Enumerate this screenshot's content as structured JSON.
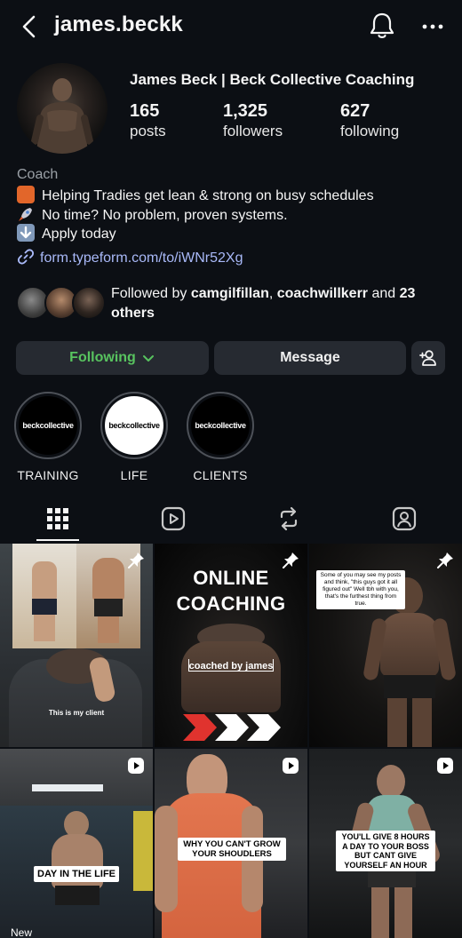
{
  "header": {
    "username": "james.beckk"
  },
  "profile": {
    "display_name": "James Beck | Beck Collective Coaching",
    "stats": [
      {
        "value": "165",
        "label": "posts"
      },
      {
        "value": "1,325",
        "label": "followers"
      },
      {
        "value": "627",
        "label": "following"
      }
    ],
    "category": "Coach",
    "bio": [
      {
        "emoji": "safety-vest",
        "text": "Helping Tradies get lean & strong on busy schedules"
      },
      {
        "emoji": "rocket",
        "text": "No time? No problem, proven systems."
      },
      {
        "emoji": "down-arrow",
        "text": "Apply today"
      }
    ],
    "link": "form.typeform.com/to/iWNr52Xg",
    "followed_by": {
      "prefix": "Followed by ",
      "user1": "camgilfillan",
      "sep": ", ",
      "user2": "coachwillkerr",
      "mid": " and ",
      "count": "23",
      "suffix": "others"
    }
  },
  "actions": {
    "following": "Following",
    "message": "Message"
  },
  "highlights": [
    {
      "title": "TRAINING",
      "cover_text": "beckcollective",
      "cover_bg": "#000000",
      "cover_fg": "#ffffff"
    },
    {
      "title": "LIFE",
      "cover_text": "beckcollective",
      "cover_bg": "#ffffff",
      "cover_fg": "#000000"
    },
    {
      "title": "CLIENTS",
      "cover_text": "beckcollective",
      "cover_bg": "#000000",
      "cover_fg": "#ffffff"
    }
  ],
  "tabs": [
    "grid-icon",
    "reels-icon",
    "reposts-icon",
    "tagged-icon"
  ],
  "grid": [
    {
      "type": "pinned",
      "caption": "This is my client"
    },
    {
      "type": "pinned",
      "title_line1": "ONLINE",
      "title_line2": "COACHING",
      "subtitle": "coached by james"
    },
    {
      "type": "pinned",
      "caption": "Some of you may see my posts and think, \"this guys got it all figured out\" Well tbh with you, that's the furthest thing from true."
    },
    {
      "type": "reel",
      "caption": "DAY IN THE LIFE",
      "overlay": "New"
    },
    {
      "type": "reel",
      "caption": "WHY YOU CAN'T GROW YOUR SHOUDLERS"
    },
    {
      "type": "reel",
      "caption": "YOU'LL GIVE 8 HOURS A DAY TO YOUR BOSS BUT CANT GIVE YOURSELF AN HOUR"
    }
  ],
  "colors": {
    "background": "#0c0f14",
    "button": "#262a31",
    "following_green": "#58c35f",
    "link": "#a9b9f8"
  }
}
